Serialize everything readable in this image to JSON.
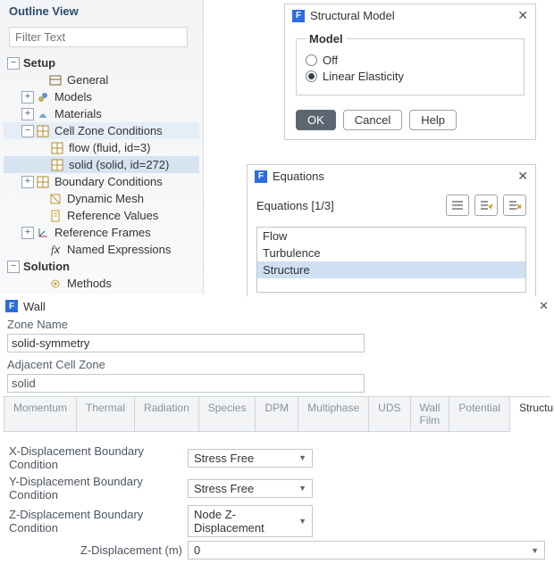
{
  "outline": {
    "title": "Outline View",
    "filter_placeholder": "Filter Text",
    "setup": "Setup",
    "general": "General",
    "models": "Models",
    "materials": "Materials",
    "czc": "Cell Zone Conditions",
    "flow": "flow (fluid, id=3)",
    "solid": "solid (solid, id=272)",
    "bc": "Boundary Conditions",
    "dyn": "Dynamic Mesh",
    "ref": "Reference Values",
    "frames": "Reference Frames",
    "named": "Named Expressions",
    "solution": "Solution",
    "methods": "Methods"
  },
  "model_dlg": {
    "title": "Structural Model",
    "legend": "Model",
    "off": "Off",
    "linear": "Linear Elasticity",
    "ok": "OK",
    "cancel": "Cancel",
    "help": "Help"
  },
  "eq_dlg": {
    "title": "Equations",
    "header": "Equations [1/3]",
    "items": [
      "Flow",
      "Turbulence",
      "Structure"
    ]
  },
  "wall": {
    "title": "Wall",
    "zone_label": "Zone Name",
    "zone_value": "solid-symmetry",
    "adj_label": "Adjacent Cell Zone",
    "adj_value": "solid",
    "tabs": {
      "momentum": "Momentum",
      "thermal": "Thermal",
      "radiation": "Radiation",
      "species": "Species",
      "dpm": "DPM",
      "multiphase": "Multiphase",
      "uds": "UDS",
      "wallfilm": "Wall Film",
      "potential": "Potential",
      "structure": "Structure"
    },
    "x_lbl": "X-Displacement Boundary Condition",
    "y_lbl": "Y-Displacement Boundary Condition",
    "z_lbl": "Z-Displacement Boundary Condition",
    "x_val": "Stress Free",
    "y_val": "Stress Free",
    "z_val": "Node Z-Displacement",
    "zdisp_lbl": "Z-Displacement (m)",
    "zdisp_val": "0"
  }
}
